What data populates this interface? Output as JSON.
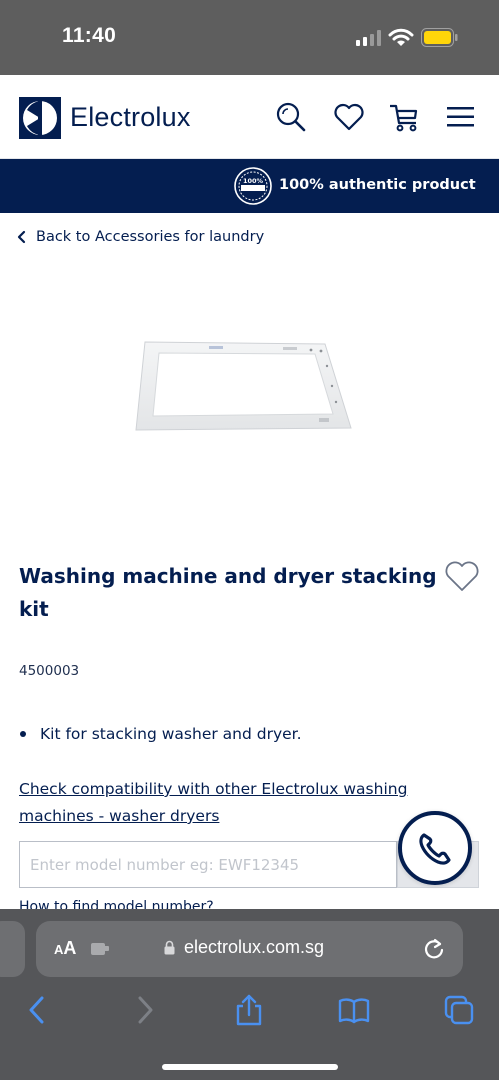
{
  "status_bar": {
    "time": "11:40"
  },
  "header": {
    "brand": "Electrolux",
    "icons": [
      "search-icon",
      "heart-icon",
      "cart-icon",
      "menu-icon"
    ]
  },
  "banner": {
    "badge_text": "100%",
    "text": "100% authentic product"
  },
  "breadcrumb": {
    "back_label": "Back to Accessories for laundry"
  },
  "product": {
    "title": "Washing machine and dryer stacking kit",
    "sku": "4500003",
    "features": [
      "Kit for stacking washer and dryer."
    ]
  },
  "compatibility": {
    "link_text": "Check compatibility with other Electrolux washing machines - washer dryers",
    "input_placeholder": "Enter model number eg: EWF12345",
    "input_value": "",
    "help_link": "How to find model number?"
  },
  "browser": {
    "text_size_label": "AA",
    "url": "electrolux.com.sg"
  },
  "colors": {
    "brand_navy": "#041e50",
    "banner_bg": "#041e50",
    "safari_bar": "#555659",
    "battery": "#ffd60a"
  }
}
